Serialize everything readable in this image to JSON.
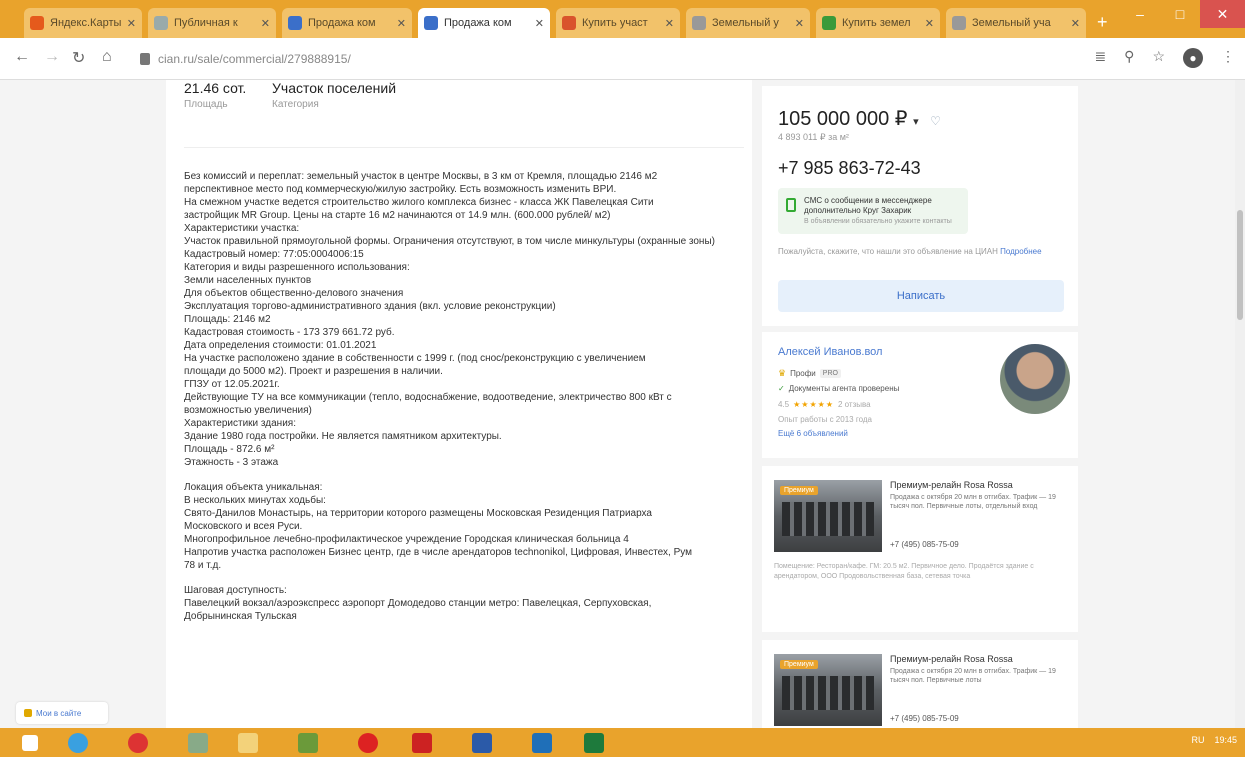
{
  "browser": {
    "tabs": [
      {
        "title": "Яндекс.Карты",
        "active": false,
        "color": "#e55a1c"
      },
      {
        "title": "Публичная к",
        "active": false,
        "color": "#9aa"
      },
      {
        "title": "Продажа ком",
        "active": false,
        "color": "#3b6fc9"
      },
      {
        "title": "Продажа ком",
        "active": true,
        "color": "#3b6fc9"
      },
      {
        "title": "Купить участ",
        "active": false,
        "color": "#d9532c"
      },
      {
        "title": "Земельный у",
        "active": false,
        "color": "#999"
      },
      {
        "title": "Купить земел",
        "active": false,
        "color": "#3a9a3a"
      },
      {
        "title": "Земельный уча",
        "active": false,
        "color": "#999"
      }
    ],
    "new_tab": "+",
    "url": "cian.ru/sale/commercial/279888915/",
    "window_min": "–",
    "window_max": "□",
    "window_close": "✕"
  },
  "main": {
    "facts": [
      {
        "value": "21.46 сот.",
        "label": "Площадь"
      },
      {
        "value": "Участок поселений",
        "label": "Категория"
      }
    ],
    "description": [
      "Без комиссий и переплат: земельный участок в центре Москвы, в 3 км от Кремля, площадью 2146 м2",
      "перспективное место под коммерческую/жилую застройку. Есть возможность изменить ВРИ.",
      "На смежном участке ведется строительство жилого комплекса бизнес - класса ЖК Павелецкая Сити",
      "застройщик МR Group. Цены на старте 16 м2 начинаются от 14.9 млн. (600.000 рублей/ м2)",
      "Характеристики участка:",
      "Участок правильной прямоугольной формы. Ограничения отсутствуют, в том числе минкультуры (охранные зоны)",
      "Кадастровый номер: 77:05:0004006:15",
      "Категория и виды разрешенного использования:",
      " Земли населенных пунктов",
      " Для объектов общественно-делового значения",
      " Эксплуатация торгово-административного здания (вкл. условие реконструкции)",
      "Площадь: 2146 м2",
      "Кадастровая стоимость - 173 379 661.72 руб.",
      "Дата определения стоимости: 01.01.2021",
      "На участке расположено здание в собственности с 1999 г. (под снос/реконструкцию с увеличением",
      "площади до 5000 м2). Проект и разрешения в наличии.",
      "ГПЗУ от 12.05.2021г.",
      " Действующие ТУ на все коммуникации (тепло, водоснабжение, водоотведение, электричество 800 кВт с",
      "возможностью увеличения)",
      "Характеристики здания:",
      "Здание 1980 года постройки. Не является памятником архитектуры.",
      "Площадь - 872.6 м²",
      "Этажность - 3 этажа",
      "",
      "Локация объекта уникальная:",
      "В нескольких минутах ходьбы:",
      "Свято-Данилов Монастырь, на территории которого размещены Московская Резиденция Патриарха",
      "Московского и всея Руси.",
      "Многопрофильное лечебно-профилактическое учреждение Городская клиническая больница  4",
      "Напротив участка расположен Бизнес центр, где в числе арендаторов technonikol, Цифровая, Инвестех, Рум",
      "78 и т.д.",
      "",
      "Шаговая доступность:",
      "Павелецкий вокзал/аэроэкспресс аэропорт Домодедово станции метро: Павелецкая, Серпуховская,",
      "Добрынинская Тульская"
    ]
  },
  "sidebar": {
    "price": "105 000 000 ₽",
    "price_caret": "▾",
    "heart_icon": "♡",
    "price_per_meter": "4 893 011 ₽ за м²",
    "phone": "+7 985 863-72-43",
    "sms_text": "СМС о сообщении в мессенджере дополнительно Круг Захарик",
    "sms_sub": "В объявлении обязательно укажите контакты",
    "note_text": "Пожалуйста, скажите, что нашли это объявление на ЦИАН",
    "note_link": "Подробнее",
    "write_button": "Написать",
    "agent": {
      "name": "Алексей Иванов.вол",
      "pro_label": "Профи",
      "pro_badge": "PRO",
      "docs": "Документы агента проверены",
      "rating": "4.5",
      "stars": "★★★★★",
      "reviews": "2 отзыва",
      "experience": "Опыт работы с 2013 года",
      "all_listings": "Ещё 6 объявлений"
    },
    "listings": [
      {
        "tag": "Премиум",
        "title": "Премиум-релайн Rosa Rossa",
        "sub": "Продажа с октября 20 млн в отгибах. Трафик — 19 тысяч пол. Первичные лоты, отдельный вход",
        "phone": "+7 (495) 085-75-09",
        "snippet": "Помещение: Ресторан/кафе. ГМ: 20.5 м2. Первичное дело. Продаётся здание с арендатором, ООО Продовольственная база, сетевая точка"
      },
      {
        "tag": "Премиум",
        "title": "Премиум-релайн Rosa Rossa",
        "sub": "Продажа с октября 20 млн в отгибах. Трафик — 19 тысяч пол. Первичные лоты",
        "phone": "+7 (495) 085-75-09",
        "snippet": ""
      }
    ]
  },
  "chat_label": "Мои в сайте",
  "taskbar": {
    "tray_lang": "RU",
    "tray_time": "19:45"
  },
  "colors": {
    "accent": "#e9a32c",
    "link": "#4a7ad0",
    "button_bg": "#e6f0fb"
  }
}
